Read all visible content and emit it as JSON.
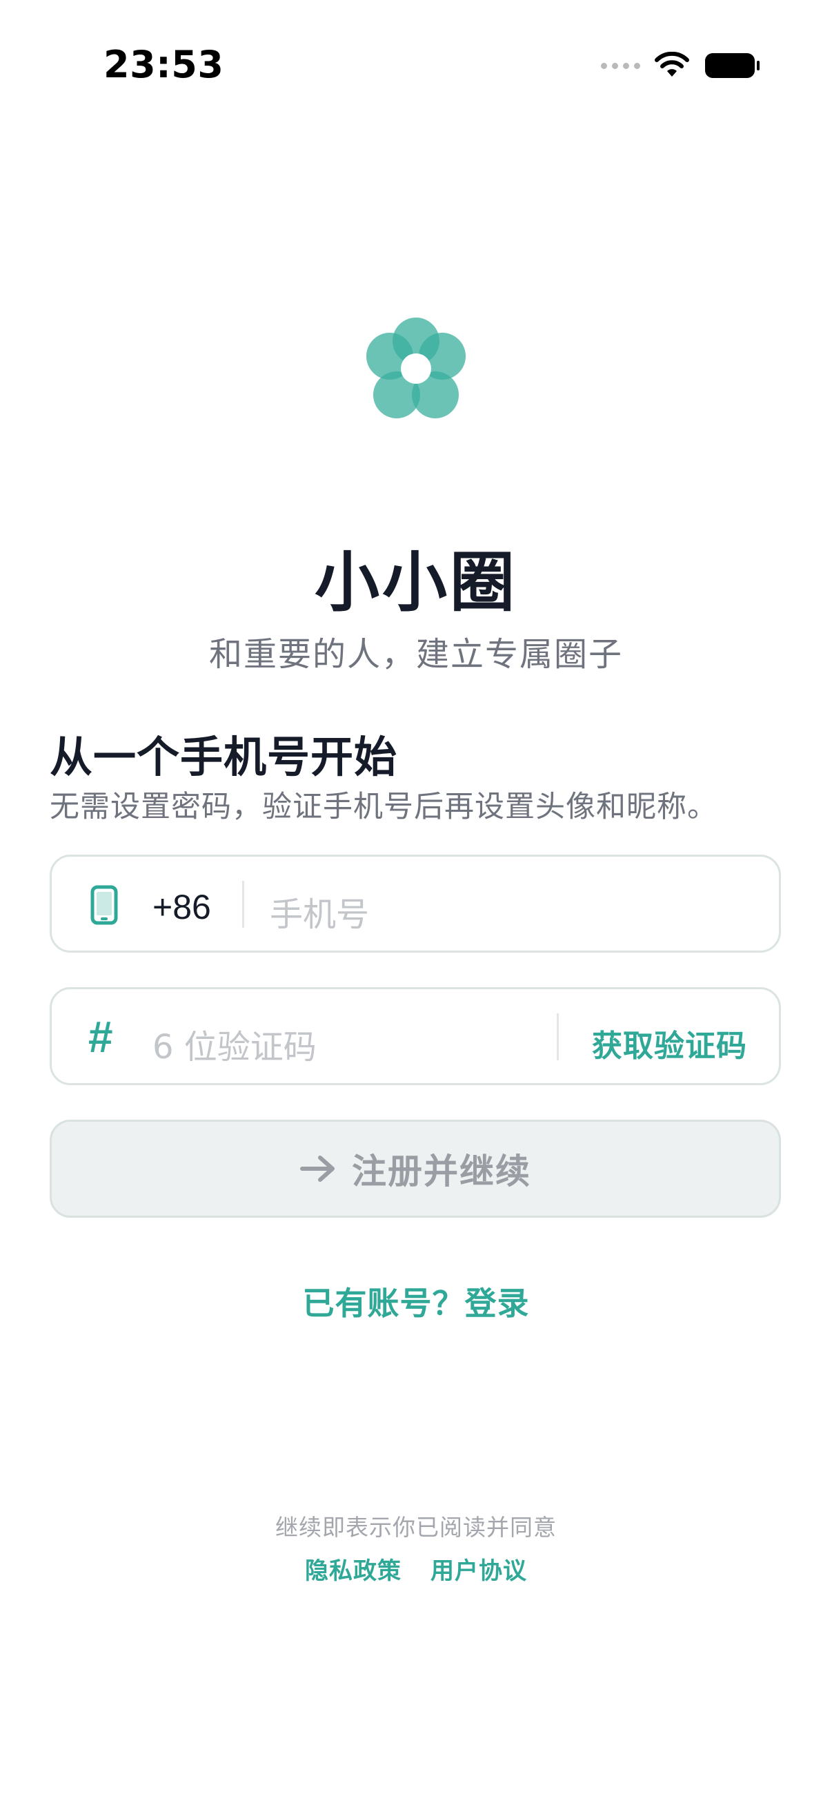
{
  "status_bar": {
    "time": "23:53"
  },
  "app": {
    "title": "小小圈",
    "subtitle": "和重要的人，建立专属圈子"
  },
  "section": {
    "heading": "从一个手机号开始",
    "description": "无需设置密码，验证手机号后再设置头像和昵称。"
  },
  "phone_field": {
    "country_code": "+86",
    "placeholder": "手机号",
    "value": ""
  },
  "code_field": {
    "placeholder": "6 位验证码",
    "value": "",
    "get_code_label": "获取验证码"
  },
  "submit_button": {
    "label": "注册并继续"
  },
  "login_link": {
    "label": "已有账号？登录"
  },
  "legal": {
    "text": "继续即表示你已阅读并同意",
    "privacy_policy": "隐私政策",
    "user_agreement": "用户协议"
  },
  "colors": {
    "accent": "#2fa898",
    "title": "#151b28",
    "muted": "#6e737d",
    "placeholder": "#c2c5c9"
  },
  "icons": [
    "flower-logo",
    "phone-icon",
    "hash-icon",
    "arrow-right-icon",
    "wifi-icon",
    "battery-icon",
    "signal-icon"
  ]
}
